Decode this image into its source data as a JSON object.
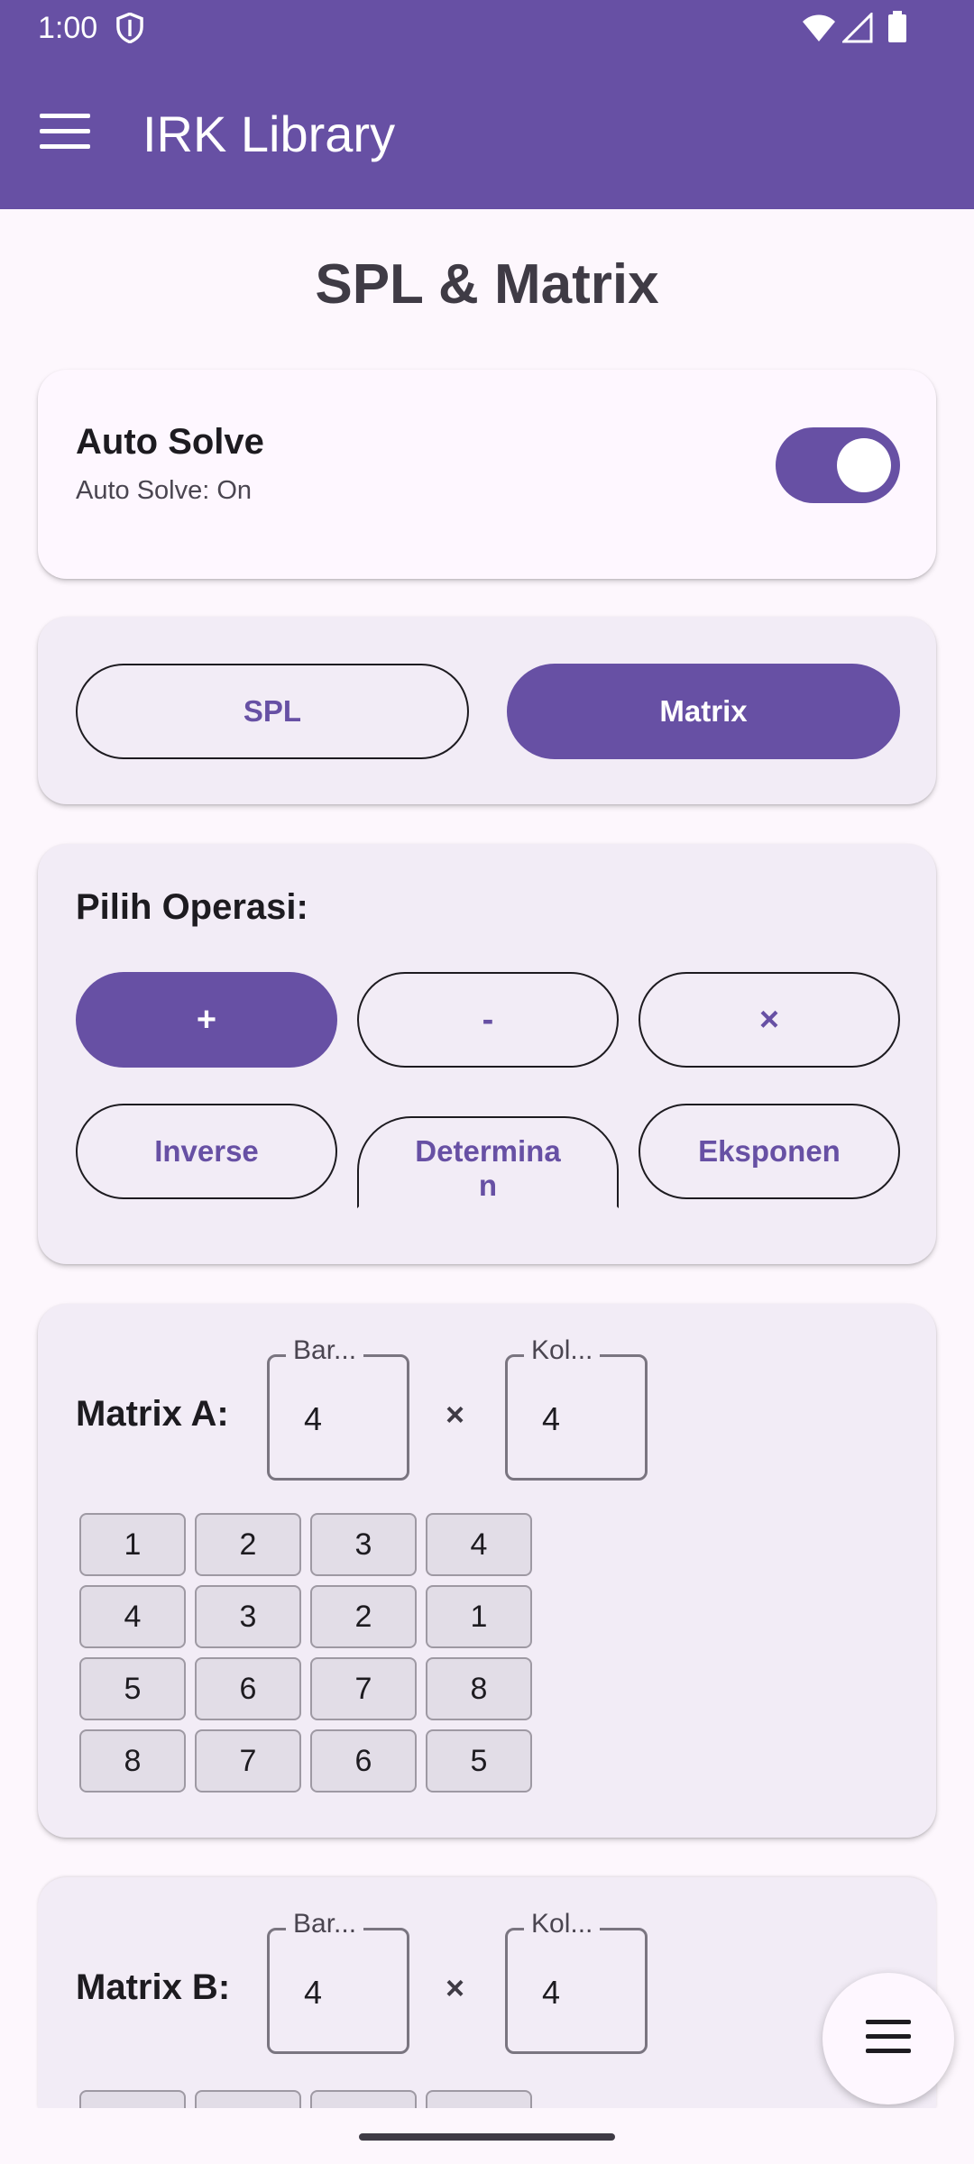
{
  "status": {
    "time": "1:00"
  },
  "appbar": {
    "title": "IRK Library"
  },
  "page": {
    "title": "SPL & Matrix"
  },
  "auto_solve": {
    "title": "Auto Solve",
    "status": "Auto Solve: On",
    "enabled": true
  },
  "mode_tabs": {
    "spl": "SPL",
    "matrix": "Matrix",
    "selected": "Matrix"
  },
  "operations": {
    "label": "Pilih Operasi:",
    "items": [
      "+",
      "-",
      "×",
      "Inverse",
      "Determina\nn",
      "Eksponen"
    ],
    "selected": "+"
  },
  "matrix_a": {
    "label": "Matrix A:",
    "rows_label": "Bar...",
    "cols_label": "Kol...",
    "rows": "4",
    "cols": "4",
    "times": "×",
    "values": [
      [
        "1",
        "2",
        "3",
        "4"
      ],
      [
        "4",
        "3",
        "2",
        "1"
      ],
      [
        "5",
        "6",
        "7",
        "8"
      ],
      [
        "8",
        "7",
        "6",
        "5"
      ]
    ]
  },
  "matrix_b": {
    "label": "Matrix B:",
    "rows_label": "Bar...",
    "cols_label": "Kol...",
    "rows": "4",
    "cols": "4",
    "times": "×"
  },
  "colors": {
    "primary": "#6750a4",
    "surface": "#fdf7fd",
    "card": "#f2ecf6"
  }
}
